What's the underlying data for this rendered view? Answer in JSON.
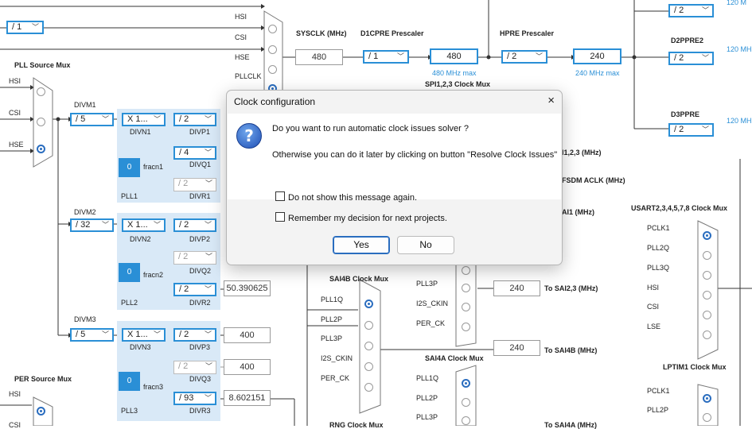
{
  "dialog": {
    "title": "Clock configuration",
    "close_icon": "×",
    "icon": "question-icon",
    "message": "Do you want to run automatic clock issues solver ?",
    "detail": "Otherwise you can do it later by clicking on button \"Resolve Clock Issues\"",
    "checkbox_dont_show": "Do not show this message again.",
    "checkbox_remember": "Remember my decision for next projects.",
    "yes_label": "Yes",
    "no_label": "No"
  },
  "diagram": {
    "top_div": "/ 1",
    "sys_mux_inputs": [
      "HSI",
      "CSI",
      "HSE",
      "PLLCLK"
    ],
    "sysclk_label": "SYSCLK (MHz)",
    "sysclk_value": "480",
    "d1cpre_label": "D1CPRE Prescaler",
    "d1cpre_value": "/ 1",
    "cpu_value": "480",
    "cpu_max": "480 MHz max",
    "hpre_label": "HPRE Prescaler",
    "hpre_value": "/ 2",
    "hclk_value": "240",
    "hclk_max": "240 MHz max",
    "spi_mux_label": "SPI1,2,3 Clock Mux",
    "right_div1": "/ 2",
    "right_div1_freq": "120 M",
    "d2ppre2_label": "D2PPRE2",
    "d2ppre2_value": "/ 2",
    "d2ppre2_freq": "120 MH",
    "d3ppre_label": "D3PPRE",
    "d3ppre_value": "/ 2",
    "d3ppre_freq": "120 MH",
    "pll_src_label": "PLL Source Mux",
    "pll_src_inputs": [
      "HSI",
      "CSI",
      "HSE"
    ],
    "plls": [
      {
        "divm_label": "DIVM1",
        "divm": "/ 5",
        "divn": "X 1...",
        "divn_label": "DIVN1",
        "divp": "/ 2",
        "divp_label": "DIVP1",
        "divq": "/ 4",
        "divq_label": "DIVQ1",
        "divr": "/ 2",
        "divr_label": "DIVR1",
        "frac": "0",
        "frac_label": "fracn1",
        "name": "PLL1"
      },
      {
        "divm_label": "DIVM2",
        "divm": "/ 32",
        "divn": "X 1...",
        "divn_label": "DIVN2",
        "divp": "/ 2",
        "divp_label": "DIVP2",
        "divq": "/ 2",
        "divq_label": "DIVQ2",
        "divr": "/ 2",
        "divr_label": "DIVR2",
        "frac": "0",
        "frac_label": "fracn2",
        "name": "PLL2",
        "out_r": "50.390625"
      },
      {
        "divm_label": "DIVM3",
        "divm": "/ 5",
        "divn": "X 1...",
        "divn_label": "DIVN3",
        "divp": "/ 2",
        "divp_label": "DIVP3",
        "divq": "/ 2",
        "divq_label": "DIVQ3",
        "divr": "/ 93",
        "divr_label": "DIVR3",
        "frac": "0",
        "frac_label": "fracn3",
        "name": "PLL3",
        "out_p": "400",
        "out_q": "400",
        "out_r": "8.602151"
      }
    ],
    "spi_out_label": "I1,2,3 (MHz)",
    "dfsdm_label": "FSDM ACLK (MHz)",
    "sai1_label": "AI1 (MHz)",
    "sai4b_mux_label": "SAI4B Clock Mux",
    "sai4b_inputs": [
      "PLL1Q",
      "PLL2P",
      "PLL3P",
      "I2S_CKIN",
      "PER_CK"
    ],
    "sai23_inputs": [
      "PLL3P",
      "I2S_CKIN",
      "PER_CK"
    ],
    "sai23_value": "240",
    "sai23_label": "To SAI2,3 (MHz)",
    "sai4b_value": "240",
    "sai4b_out_label": "To SAI4B (MHz)",
    "sai4a_mux_label": "SAI4A Clock Mux",
    "sai4a_inputs": [
      "PLL1Q",
      "PLL2P",
      "PLL3P"
    ],
    "sai4a_out_label": "To SAI4A (MHz)",
    "rng_label": "RNG Clock Mux",
    "usart_mux_label": "USART2,3,4,5,7,8 Clock Mux",
    "usart_inputs": [
      "PCLK1",
      "PLL2Q",
      "PLL3Q",
      "HSI",
      "CSI",
      "LSE"
    ],
    "lptim1_label": "LPTIM1 Clock Mux",
    "lptim_inputs": [
      "PCLK1",
      "PLL2P"
    ],
    "per_label": "PER Source Mux",
    "per_inputs": [
      "HSI",
      "CSI"
    ]
  }
}
